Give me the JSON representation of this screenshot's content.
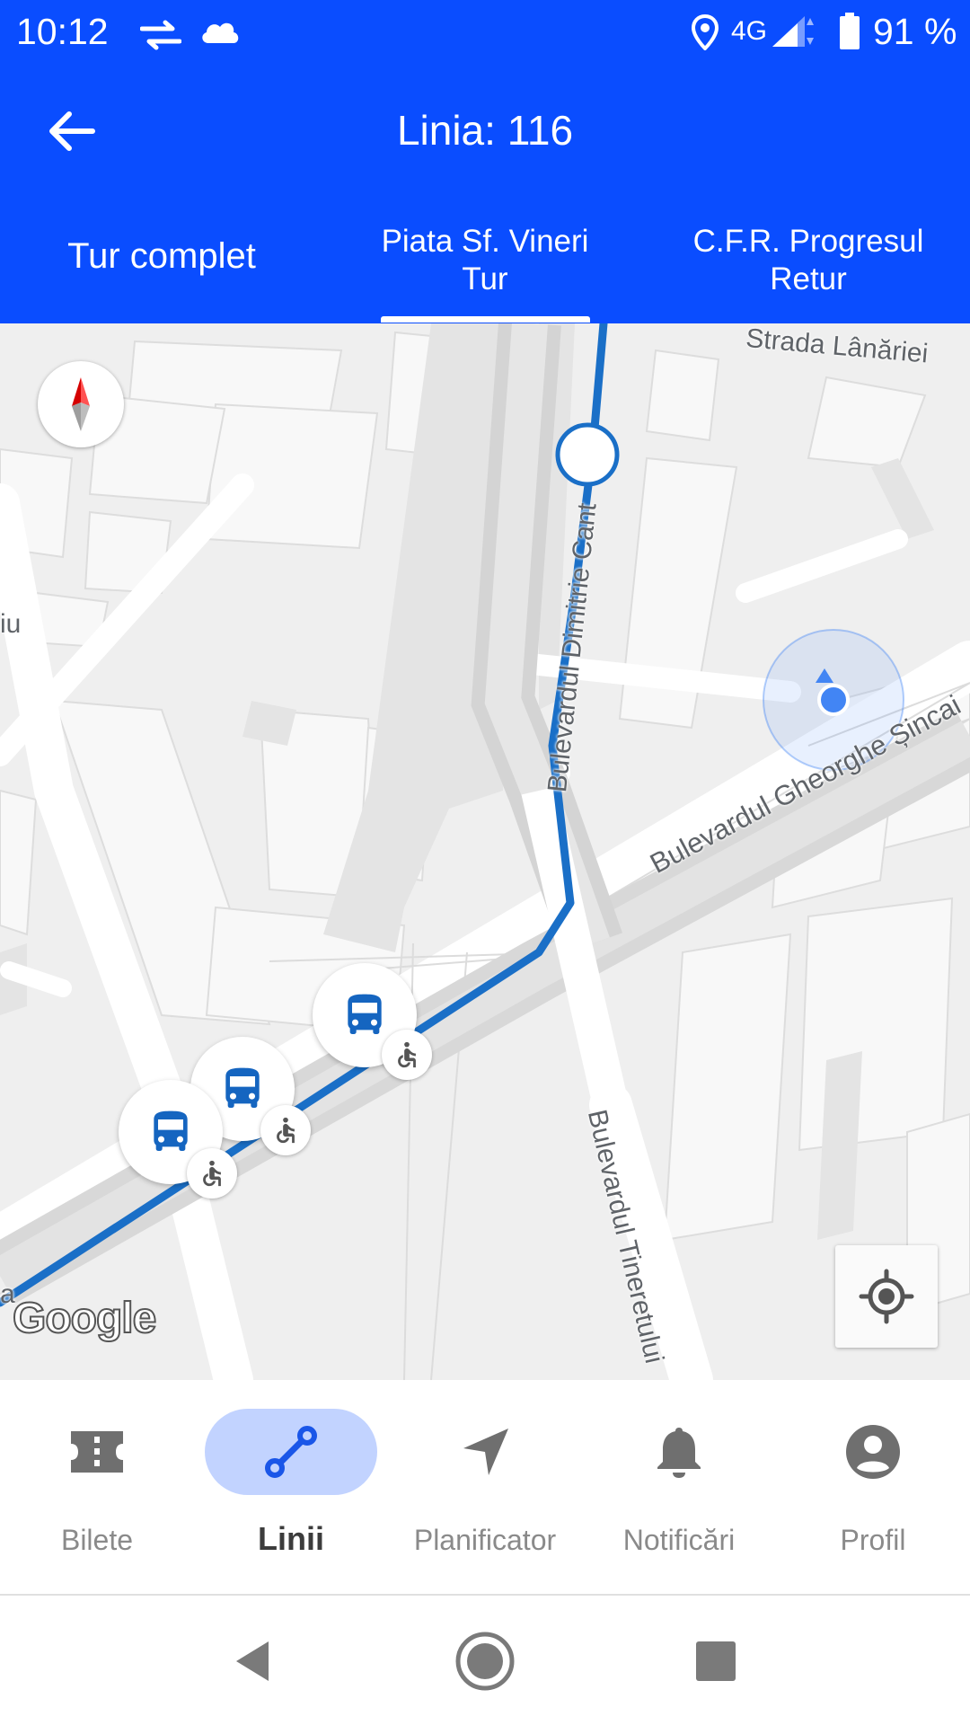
{
  "status_bar": {
    "time": "10:12",
    "network": "4G",
    "battery": "91 %",
    "icons": [
      "data-transfer-icon",
      "cloud-icon",
      "location-icon",
      "signal-icon",
      "battery-icon"
    ]
  },
  "app_bar": {
    "title": "Linia: 116",
    "back_icon": "arrow-back-icon"
  },
  "tabs": {
    "tur_complet": "Tur complet",
    "tur_line1": "Piata Sf. Vineri",
    "tur_line2": "Tur",
    "retur_line1": "C.F.R. Progresul",
    "retur_line2": "Retur",
    "active": "tur"
  },
  "map": {
    "streets": {
      "lanariei": "Strada Lânăriei",
      "cantemir": "Bulevardul Dimitrie Cant",
      "sincai": "Bulevardul Gheorghe Șincai",
      "tineretului": "Bulevardul Tineretului",
      "edge_left": "iu",
      "edge_bottom": "a"
    },
    "google_logo": "Google",
    "route_color": "#1a6fc7",
    "bus_icon_color": "#1565c0",
    "location_dot_color": "#4285f4"
  },
  "bottom_nav": {
    "items": [
      {
        "label": "Bilete",
        "icon": "ticket-icon"
      },
      {
        "label": "Linii",
        "icon": "route-icon"
      },
      {
        "label": "Planificator",
        "icon": "navigation-arrow-icon"
      },
      {
        "label": "Notificări",
        "icon": "bell-icon"
      },
      {
        "label": "Profil",
        "icon": "account-circle-icon"
      }
    ],
    "active_index": 1,
    "active_pill_color": "#c2d3ff"
  },
  "colors": {
    "primary": "#0a4dff"
  }
}
